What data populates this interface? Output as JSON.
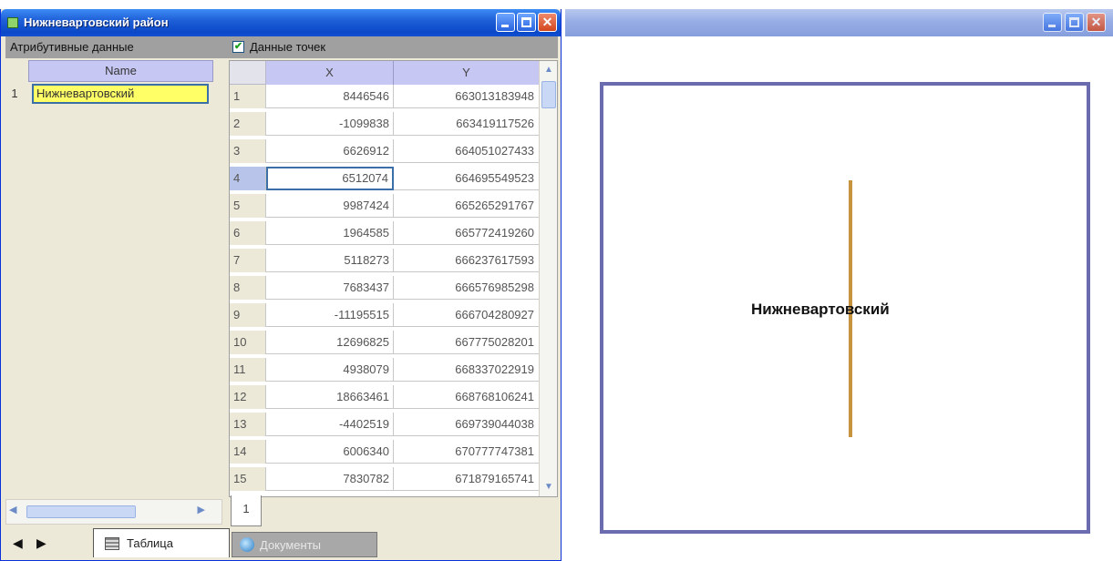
{
  "left_window": {
    "title": "Нижневартовский район",
    "attr_tab_label": "Атрибутивные данные",
    "points_checkbox_label": "Данные точек",
    "points_checkbox_mark": "✔",
    "attr_table": {
      "column": "Name",
      "rows": [
        {
          "num": "1",
          "name": "Нижневартовский"
        }
      ]
    },
    "points_table": {
      "columns": [
        "X",
        "Y"
      ],
      "rows": [
        {
          "n": "1",
          "x": "8446546",
          "y": "663013183948"
        },
        {
          "n": "2",
          "x": "-1099838",
          "y": "663419117526"
        },
        {
          "n": "3",
          "x": "6626912",
          "y": "664051027433"
        },
        {
          "n": "4",
          "x": "6512074",
          "y": "664695549523"
        },
        {
          "n": "5",
          "x": "9987424",
          "y": "665265291767"
        },
        {
          "n": "6",
          "x": "1964585",
          "y": "665772419260"
        },
        {
          "n": "7",
          "x": "5118273",
          "y": "666237617593"
        },
        {
          "n": "8",
          "x": "7683437",
          "y": "666576985298"
        },
        {
          "n": "9",
          "x": "-11195515",
          "y": "666704280927"
        },
        {
          "n": "10",
          "x": "12696825",
          "y": "667775028201"
        },
        {
          "n": "11",
          "x": "4938079",
          "y": "668337022919"
        },
        {
          "n": "12",
          "x": "18663461",
          "y": "668768106241"
        },
        {
          "n": "13",
          "x": "-4402519",
          "y": "669739044038"
        },
        {
          "n": "14",
          "x": "6006340",
          "y": "670777747381"
        },
        {
          "n": "15",
          "x": "7830782",
          "y": "671879165741"
        }
      ],
      "selected_row": "4"
    },
    "subtab_label": "1",
    "nav_prev": "◀",
    "nav_next": "▶",
    "tabs": {
      "table": "Таблица",
      "documents": "Документы"
    }
  },
  "right_window": {
    "map_label": "Нижневартовский"
  },
  "colors": {
    "title_blue": "#0a48c8",
    "selected_cell": "#ffff66",
    "feature_line": "#c8933f",
    "map_border": "#6b6bb0"
  }
}
